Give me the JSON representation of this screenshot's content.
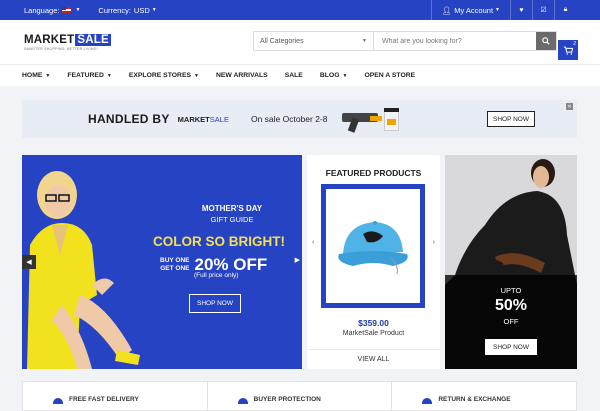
{
  "topbar": {
    "language_label": "Language:",
    "currency_label": "Currency:",
    "currency_value": "USD",
    "account_label": "My Account"
  },
  "logo": {
    "main": "MARKET",
    "highlight": "SALE",
    "tagline": "SMARTER SHOPPING, BETTER LIVING!"
  },
  "search": {
    "category": "All Categories",
    "placeholder": "What are you looking for?"
  },
  "cart": {
    "count": "2"
  },
  "nav": [
    "HOME",
    "FEATURED",
    "EXPLORE STORES",
    "NEW ARRIVALS",
    "SALE",
    "BLOG",
    "OPEN A STORE"
  ],
  "banner": {
    "handled": "HANDLED BY",
    "brand_main": "MARKET",
    "brand_accent": "SALE",
    "sale_text": "On sale October 2-8",
    "shop": "SHOP NOW"
  },
  "hero": {
    "line1": "MOTHER'S DAY",
    "line2": "GIFT GUIDE",
    "headline": "COLOR SO BRIGHT!",
    "buy_one": "BUY ONE",
    "get_one": "GET ONE",
    "percent": "20% OFF",
    "full_price": "(Full price only)",
    "shop": "SHOP NOW"
  },
  "featured": {
    "title": "FEATURED PRODUCTS",
    "price": "$359.00",
    "product_name": "MarketSale Product",
    "view_all": "VIEW ALL"
  },
  "promo": {
    "upto": "UPTO",
    "percent": "50%",
    "off": "OFF",
    "shop": "SHOP NOW"
  },
  "features": [
    "FREE FAST DELIVERY",
    "BUYER PROTECTION",
    "RETURN & EXCHANGE"
  ],
  "colors": {
    "brand": "#2643c4",
    "accent_yellow": "#f4e04d"
  }
}
